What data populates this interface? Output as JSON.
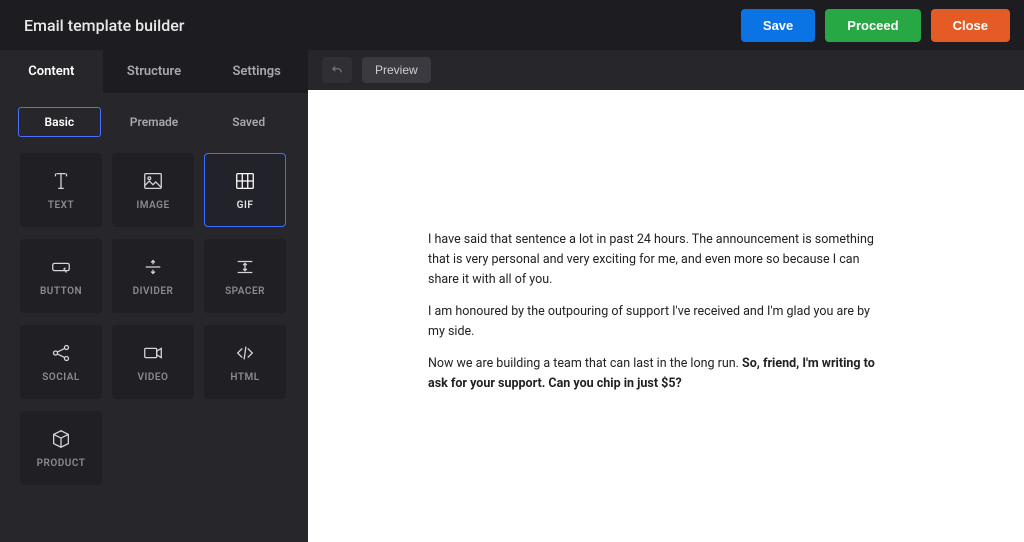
{
  "header": {
    "title": "Email template builder",
    "buttons": {
      "save": "Save",
      "proceed": "Proceed",
      "close": "Close"
    }
  },
  "sidebar": {
    "main_tabs": {
      "content": "Content",
      "structure": "Structure",
      "settings": "Settings",
      "active": "content"
    },
    "sub_tabs": {
      "basic": "Basic",
      "premade": "Premade",
      "saved": "Saved",
      "active": "basic"
    },
    "blocks": {
      "text": "TEXT",
      "image": "IMAGE",
      "gif": "GIF",
      "button": "BUTTON",
      "divider": "DIVIDER",
      "spacer": "SPACER",
      "social": "SOCIAL",
      "video": "VIDEO",
      "html": "HTML",
      "product": "PRODUCT",
      "selected": "gif"
    }
  },
  "canvas_toolbar": {
    "preview": "Preview"
  },
  "email": {
    "p1": "I have said that sentence a lot in past 24 hours. The announcement is something that is very personal and very exciting for me, and even more so because I can share it with all of you.",
    "p2": "I am honoured by the outpouring of support I've received and I'm glad you are by my side.",
    "p3a": "Now we are building a team that can last in the long run. ",
    "p3b": "So, friend, I'm writing to ask for your support. Can you chip in just $5?"
  }
}
